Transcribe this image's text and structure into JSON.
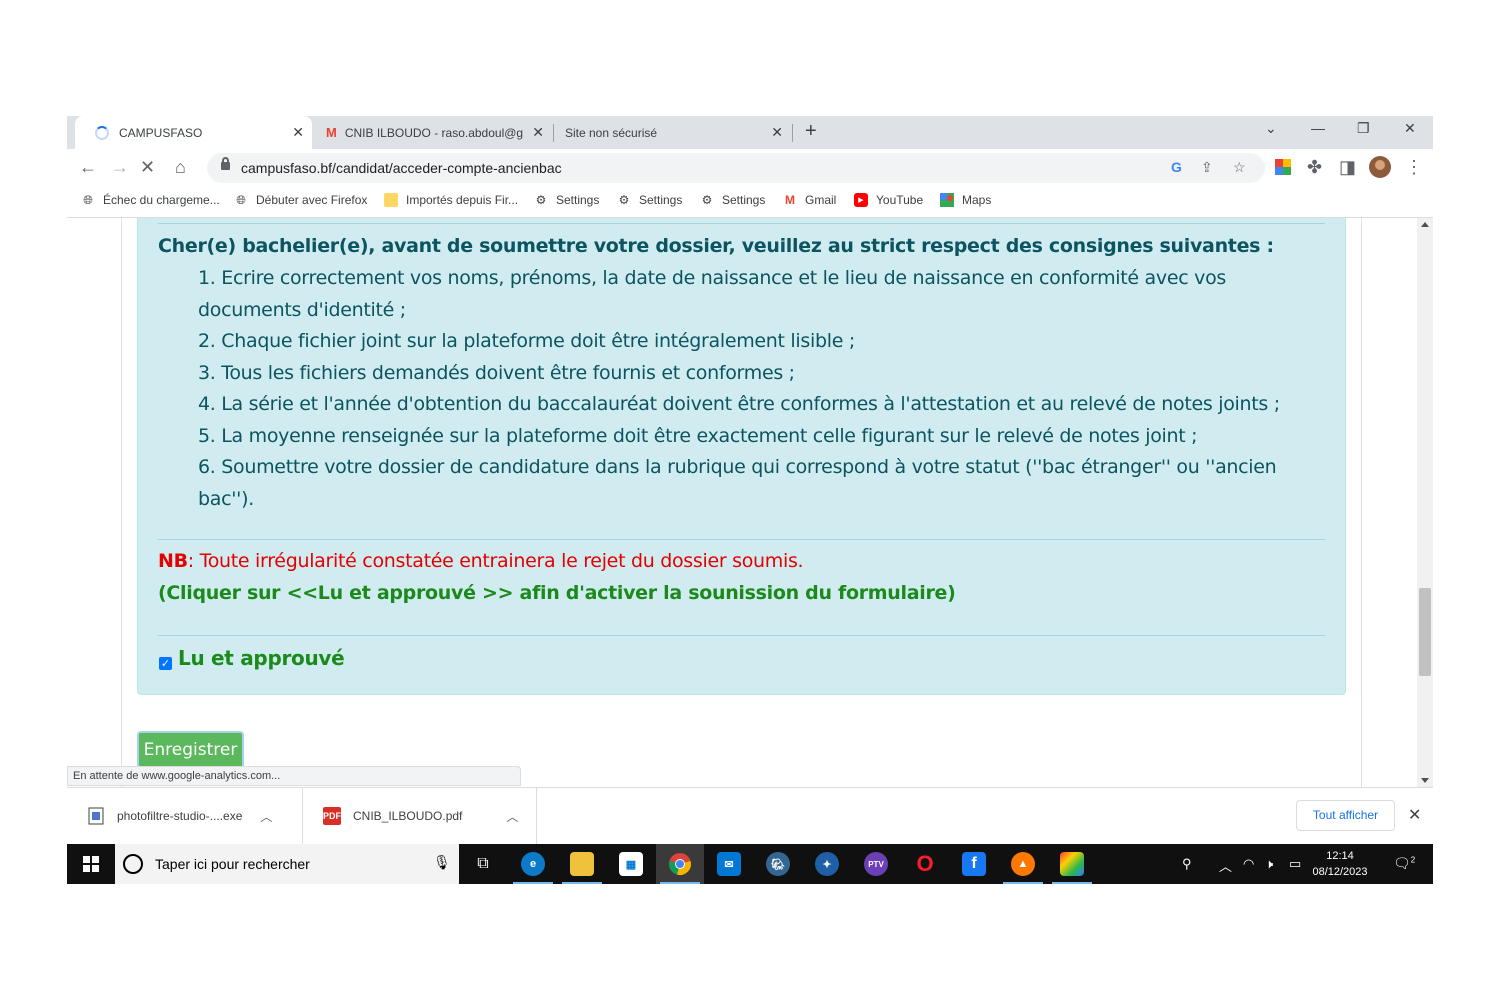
{
  "browser": {
    "tabs": [
      {
        "title": "CAMPUSFASO",
        "active": true
      },
      {
        "title": "CNIB ILBOUDO - raso.abdoul@g",
        "active": false
      },
      {
        "title": "Site non sécurisé",
        "active": false
      }
    ],
    "url": "campusfaso.bf/candidat/acceder-compte-ancienbac",
    "bookmarks": [
      "Échec du chargeme...",
      "Débuter avec Firefox",
      "Importés depuis Fir...",
      "Settings",
      "Settings",
      "Settings",
      "Gmail",
      "YouTube",
      "Maps"
    ],
    "status_text": "En attente de www.google-analytics.com..."
  },
  "page": {
    "intro": "Cher(e) bachelier(e), avant de soumettre votre dossier, veuillez au strict respect des consignes suivantes :",
    "rules": [
      "1. Ecrire correctement vos noms, prénoms, la date de naissance et le lieu de naissance en conformité avec vos documents d'identité ;",
      "2. Chaque fichier joint sur la plateforme doit être intégralement lisible ;",
      "3. Tous les fichiers demandés doivent être fournis et conformes ;",
      "4. La série et l'année d'obtention du baccalauréat doivent être conformes à l'attestation et au relevé de notes joints ;",
      "5. La moyenne renseignée sur la plateforme doit être exactement celle figurant sur le relevé de notes joint ;",
      "6. Soumettre votre dossier de candidature dans la rubrique qui correspond à votre statut (''bac étranger'' ou ''ancien bac'')."
    ],
    "nb_label": "NB",
    "nb_text": ": Toute irrégularité constatée entrainera le rejet du dossier soumis.",
    "click_note": "(Cliquer sur <<Lu et approuvé >> afin d'activer la sounission du formulaire)",
    "checkbox_label": "Lu et approuvé",
    "checkbox_checked": true,
    "save_label": "Enregistrer"
  },
  "downloads": {
    "items": [
      "photofiltre-studio-....exe",
      "CNIB_ILBOUDO.pdf"
    ],
    "show_all": "Tout afficher"
  },
  "taskbar": {
    "search_placeholder": "Taper ici pour rechercher",
    "time": "12:14",
    "date": "08/12/2023",
    "notification_count": "2"
  },
  "colors": {
    "alert_bg": "#d1ecf1",
    "alert_text": "#0c5460",
    "warning_red": "#e50000",
    "note_green": "#1b8a1b",
    "button_green": "#5cb85c"
  }
}
